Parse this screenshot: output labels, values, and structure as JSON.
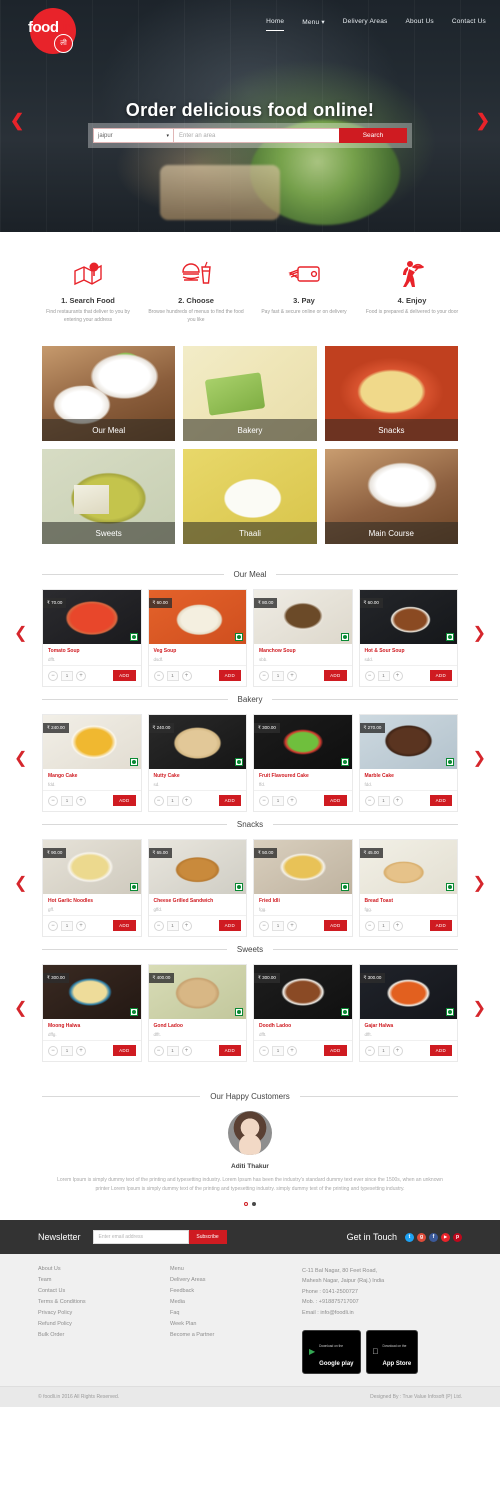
{
  "nav": {
    "logo_main": "food",
    "logo_tld": ".in",
    "logo_badge": "ली",
    "items": [
      {
        "label": "Home",
        "active": true
      },
      {
        "label": "Menu ▾",
        "active": false
      },
      {
        "label": "Delivery Areas",
        "active": false
      },
      {
        "label": "About Us",
        "active": false
      },
      {
        "label": "Contact Us",
        "active": false
      }
    ]
  },
  "hero": {
    "title": "Order delicious food online!",
    "prev_arrow": "❮",
    "next_arrow": "❯",
    "city_value": "jaipur",
    "caret": "▾",
    "area_placeholder": "Enter an area",
    "search_label": "Search"
  },
  "steps": [
    {
      "title": "1. Search Food",
      "desc": "Find restaurants that deliver to you by entering your address",
      "icon": "map-pin-icon"
    },
    {
      "title": "2. Choose",
      "desc": "Browse hundreds of menus to find the food you like",
      "icon": "burger-drink-icon"
    },
    {
      "title": "3. Pay",
      "desc": "Pay fast & secure online or on delivery",
      "icon": "credit-card-wallet-icon"
    },
    {
      "title": "4. Enjoy",
      "desc": "Food is prepared & delivered to your door",
      "icon": "delivery-waiter-icon"
    }
  ],
  "categories": [
    {
      "label": "Our Meal",
      "css": "ci-meal"
    },
    {
      "label": "Bakery",
      "css": "ci-bakery"
    },
    {
      "label": "Snacks",
      "css": "ci-snacks"
    },
    {
      "label": "Sweets",
      "css": "ci-sweets"
    },
    {
      "label": "Thaali",
      "css": "ci-thaali"
    },
    {
      "label": "Main Course",
      "css": "ci-maincourse"
    }
  ],
  "controls": {
    "minus": "−",
    "plus": "+",
    "qty": "1",
    "add_label": "ADD",
    "prev_arrow": "❮",
    "next_arrow": "❯"
  },
  "sections": [
    {
      "title": "Our Meal",
      "products": [
        {
          "name": "Tomato Soup",
          "price": "₹ 70.00",
          "desc": "dfft.",
          "css": "pi-tomato"
        },
        {
          "name": "Veg Soup",
          "price": "₹ 60.00",
          "desc": "dsdf.",
          "css": "pi-veg"
        },
        {
          "name": "Manchow Soup",
          "price": "₹ 80.00",
          "desc": "sbb.",
          "css": "pi-manchow"
        },
        {
          "name": "Hot & Sour Soup",
          "price": "₹ 60.00",
          "desc": "sdd.",
          "css": "pi-hotsour"
        }
      ]
    },
    {
      "title": "Bakery",
      "products": [
        {
          "name": "Mango Cake",
          "price": "₹ 240.00",
          "desc": "fdd.",
          "css": "pi-mango"
        },
        {
          "name": "Nutty Cake",
          "price": "₹ 240.00",
          "desc": "sd.",
          "css": "pi-nutty"
        },
        {
          "name": "Fruit Flavoured Cake",
          "price": "₹ 300.00",
          "desc": "ffd.",
          "css": "pi-fruit"
        },
        {
          "name": "Marble Cake",
          "price": "₹ 270.00",
          "desc": "fdd.",
          "css": "pi-marble"
        }
      ]
    },
    {
      "title": "Snacks",
      "products": [
        {
          "name": "Hot Garlic Noodles",
          "price": "₹ 90.00",
          "desc": "gff.",
          "css": "pi-noodles"
        },
        {
          "name": "Cheese Grilled Sandwich",
          "price": "₹ 65.00",
          "desc": "gffd.",
          "css": "pi-sandwich"
        },
        {
          "name": "Fried Idli",
          "price": "₹ 50.00",
          "desc": "fgg.",
          "css": "pi-idli"
        },
        {
          "name": "Bread Toast",
          "price": "₹ 45.00",
          "desc": "fgg.",
          "css": "pi-toast"
        }
      ]
    },
    {
      "title": "Sweets",
      "products": [
        {
          "name": "Moong Halwa",
          "price": "₹ 300.00",
          "desc": "dffg.",
          "css": "pi-moong"
        },
        {
          "name": "Gond Ladoo",
          "price": "₹ 400.00",
          "desc": "dfft.",
          "css": "pi-gond"
        },
        {
          "name": "Doodh Ladoo",
          "price": "₹ 300.00",
          "desc": "dfft.",
          "css": "pi-doodh"
        },
        {
          "name": "Gajar Halwa",
          "price": "₹ 300.00",
          "desc": "dfft.",
          "css": "pi-gajar"
        }
      ]
    }
  ],
  "testimonial": {
    "heading": "Our Happy Customers",
    "name": "Aditi Thakur",
    "text": "Lorem Ipsum is simply dummy text of the printing and typesetting industry. Lorem Ipsum has been the industry's standard dummy text ever since the 1500s, when an unknown printer Lorem Ipsum is simply dummy text of the printing and typesetting industry. simply dummy text of the printing and typesetting industry."
  },
  "newsletter": {
    "title": "Newsletter",
    "email_placeholder": "Enter email address",
    "subscribe_label": "Subscribe",
    "git_title": "Get in Touch",
    "socials": [
      {
        "name": "twitter-icon",
        "glyph": "t",
        "color": "#1da1f2"
      },
      {
        "name": "googleplus-icon",
        "glyph": "g",
        "color": "#dd4b39"
      },
      {
        "name": "facebook-icon",
        "glyph": "f",
        "color": "#3b5998"
      },
      {
        "name": "youtube-icon",
        "glyph": "▶",
        "color": "#e8232a"
      },
      {
        "name": "pinterest-icon",
        "glyph": "p",
        "color": "#bd081c"
      }
    ]
  },
  "footer": {
    "col1": [
      "About Us",
      "Team",
      "Contact Us",
      "Terms & Conditions",
      "Privacy Policy",
      "Refund Policy",
      "Bulk Order"
    ],
    "col2": [
      "Menu",
      "Delivery Areas",
      "Feedback",
      "Media",
      "Faq",
      "Week Plan",
      "Become a Partner"
    ],
    "address_line1": "C-11 Bal Nagar, 80 Feet Road,",
    "address_line2": "Mahesh Nagar, Jaipur (Raj.) India",
    "phone": "Phone : 0141-2500727",
    "mobile": "Mob. : +918875717007",
    "email": "Email : info@foodli.in",
    "google_play": {
      "sub": "Download on the",
      "name": "Google play"
    },
    "app_store": {
      "sub": "Download on the",
      "name": "App Store"
    }
  },
  "copyright": {
    "left": "© foodli.in 2016 All Rights Reserved.",
    "right": "Designed By : True Value Infosoft (P) Ltd."
  }
}
